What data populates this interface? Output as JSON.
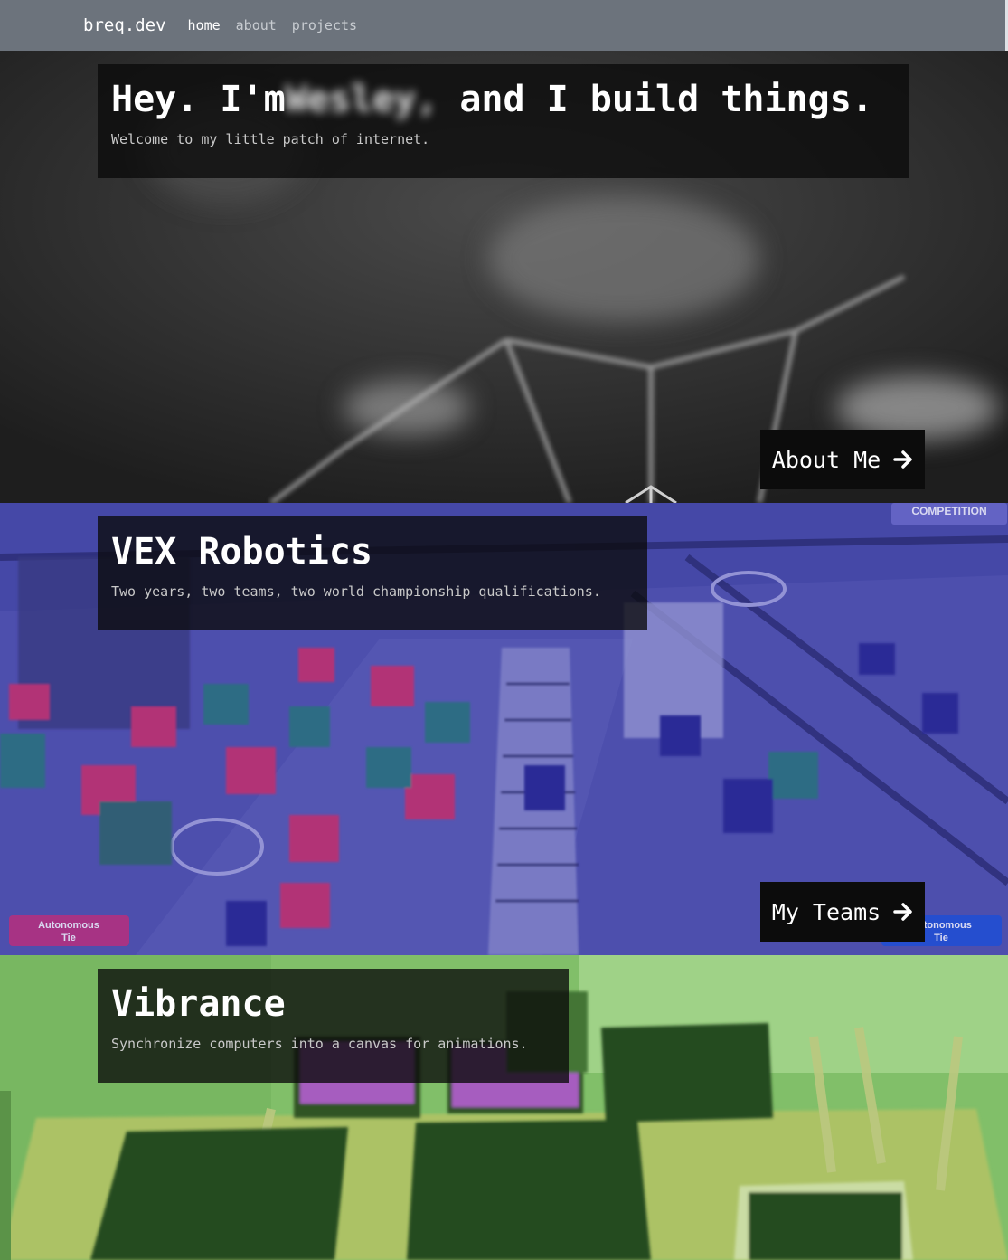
{
  "navbar": {
    "brand": "breq.dev",
    "links": [
      {
        "label": "home",
        "active": true
      },
      {
        "label": "about",
        "active": false
      },
      {
        "label": "projects",
        "active": false
      }
    ],
    "background_color": "#6c737c"
  },
  "sections": {
    "hero": {
      "title_prefix": "Hey. I'm",
      "title_name_blurred": "Wesley,",
      "title_suffix": " and I build things.",
      "subtitle": "Welcome to my little patch of internet.",
      "button_label": "About Me",
      "button_icon": "arrow-right-icon",
      "tint_color": "#262626"
    },
    "vex": {
      "title": "VEX Robotics",
      "subtitle": "Two years, two teams, two world championship qualifications.",
      "button_label": "My Teams",
      "button_icon": "arrow-right-icon",
      "tint_color": "#3d3f99",
      "overlay_badges": {
        "top_right": "COMPETITION",
        "bottom_left": "Autonomous\nTie",
        "bottom_right": "Autonomous\nTie"
      }
    },
    "vibrance": {
      "title": "Vibrance",
      "subtitle": "Synchronize computers into a canvas for animations.",
      "tint_color": "#7fb86a"
    }
  }
}
